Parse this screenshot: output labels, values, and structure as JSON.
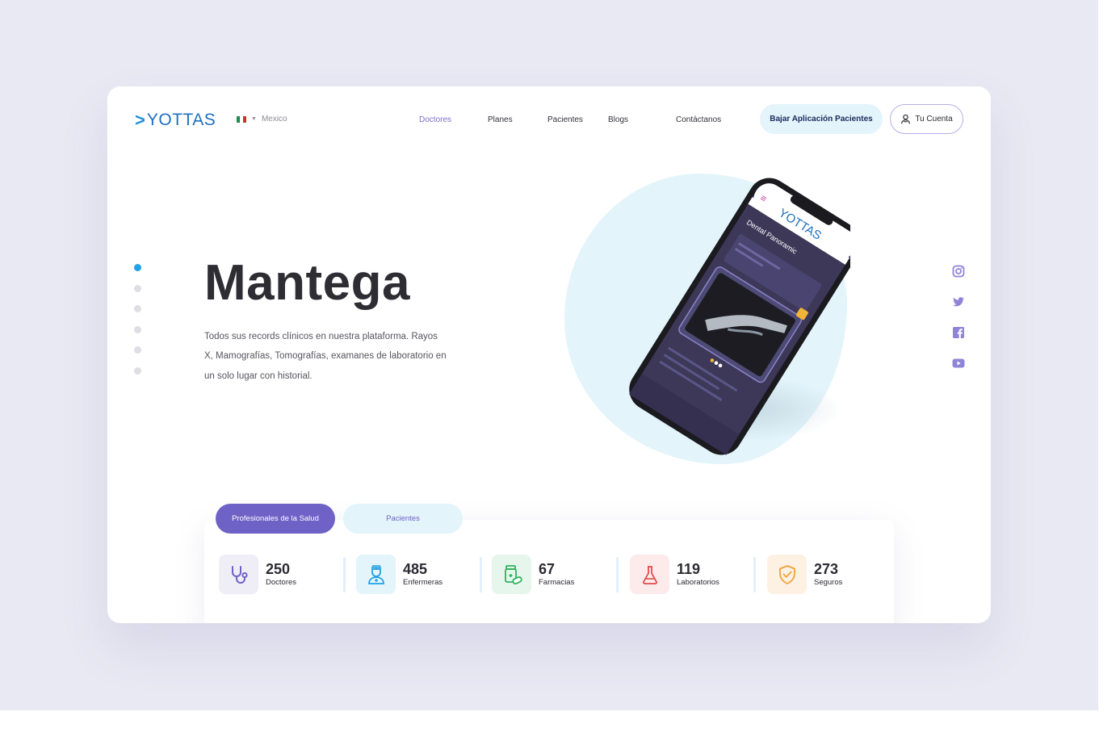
{
  "header": {
    "logo_text": "YOTTAS",
    "country": "Mexico",
    "nav": [
      "Doctores",
      "Planes",
      "Pacientes",
      "Blogs",
      "Contáctanos"
    ],
    "download_button": "Bajar Aplicación Pacientes",
    "account_button": "Tu Cuenta"
  },
  "hero": {
    "title": "Mantega",
    "description": "Todos sus records clínicos en nuestra plataforma. Rayos X, Mamografías, Tomografías, examanes de laboratorio en un solo lugar con historial."
  },
  "phone_screen": {
    "app_logo": "YOTTAS",
    "screen_title": "Dental Panoramic"
  },
  "tabs": [
    "Profesionales de la Salud",
    "Pacientes"
  ],
  "stats": [
    {
      "value": "250",
      "label": "Doctores",
      "icon": "stethoscope-icon"
    },
    {
      "value": "485",
      "label": "Enfermeras",
      "icon": "nurse-icon"
    },
    {
      "value": "67",
      "label": "Farmacias",
      "icon": "medicine-icon"
    },
    {
      "value": "119",
      "label": "Laboratorios",
      "icon": "flask-icon"
    },
    {
      "value": "273",
      "label": "Seguros",
      "icon": "shield-check-icon"
    }
  ],
  "social": [
    "instagram-icon",
    "twitter-icon",
    "facebook-icon",
    "youtube-icon"
  ],
  "slider": {
    "count": 6,
    "active_index": 0
  },
  "colors": {
    "accent_purple": "#6e62c6",
    "accent_blue": "#1fa1e6",
    "light_blue": "#e3f4fb",
    "background": "#e9e9f4"
  }
}
